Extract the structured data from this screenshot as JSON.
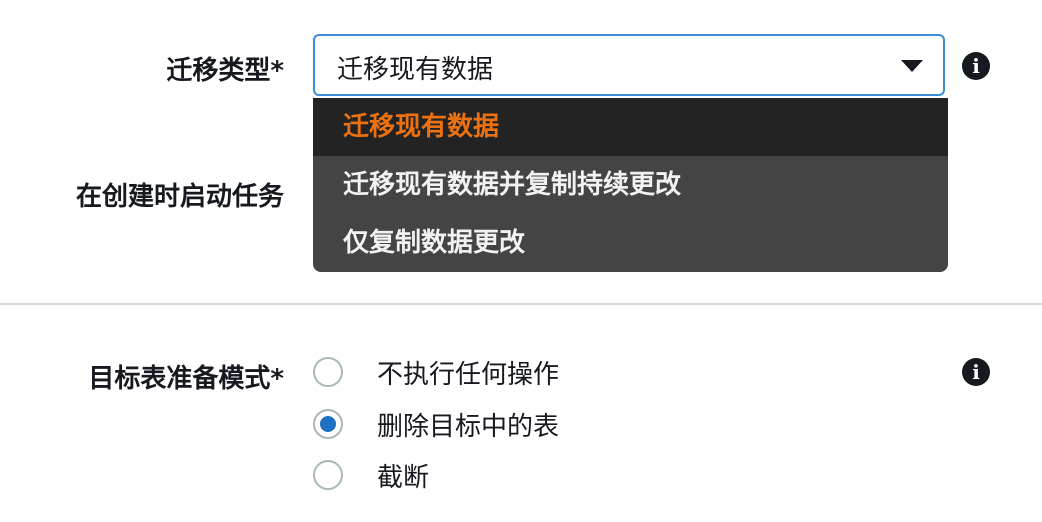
{
  "migration_type": {
    "label": "迁移类型*",
    "selected": "迁移现有数据",
    "options": [
      "迁移现有数据",
      "迁移现有数据并复制持续更改",
      "仅复制数据更改"
    ]
  },
  "start_task": {
    "label": "在创建时启动任务"
  },
  "target_prep": {
    "label": "目标表准备模式*",
    "options": [
      "不执行任何操作",
      "删除目标中的表",
      "截断"
    ],
    "selected_index": 1
  },
  "icons": {
    "info": "i"
  },
  "colors": {
    "focus_border": "#3d8ed8",
    "menu_bg": "#444444",
    "menu_selected_bg": "#232323",
    "menu_selected_text": "#ec7211",
    "radio_checked": "#1f6fc4"
  }
}
